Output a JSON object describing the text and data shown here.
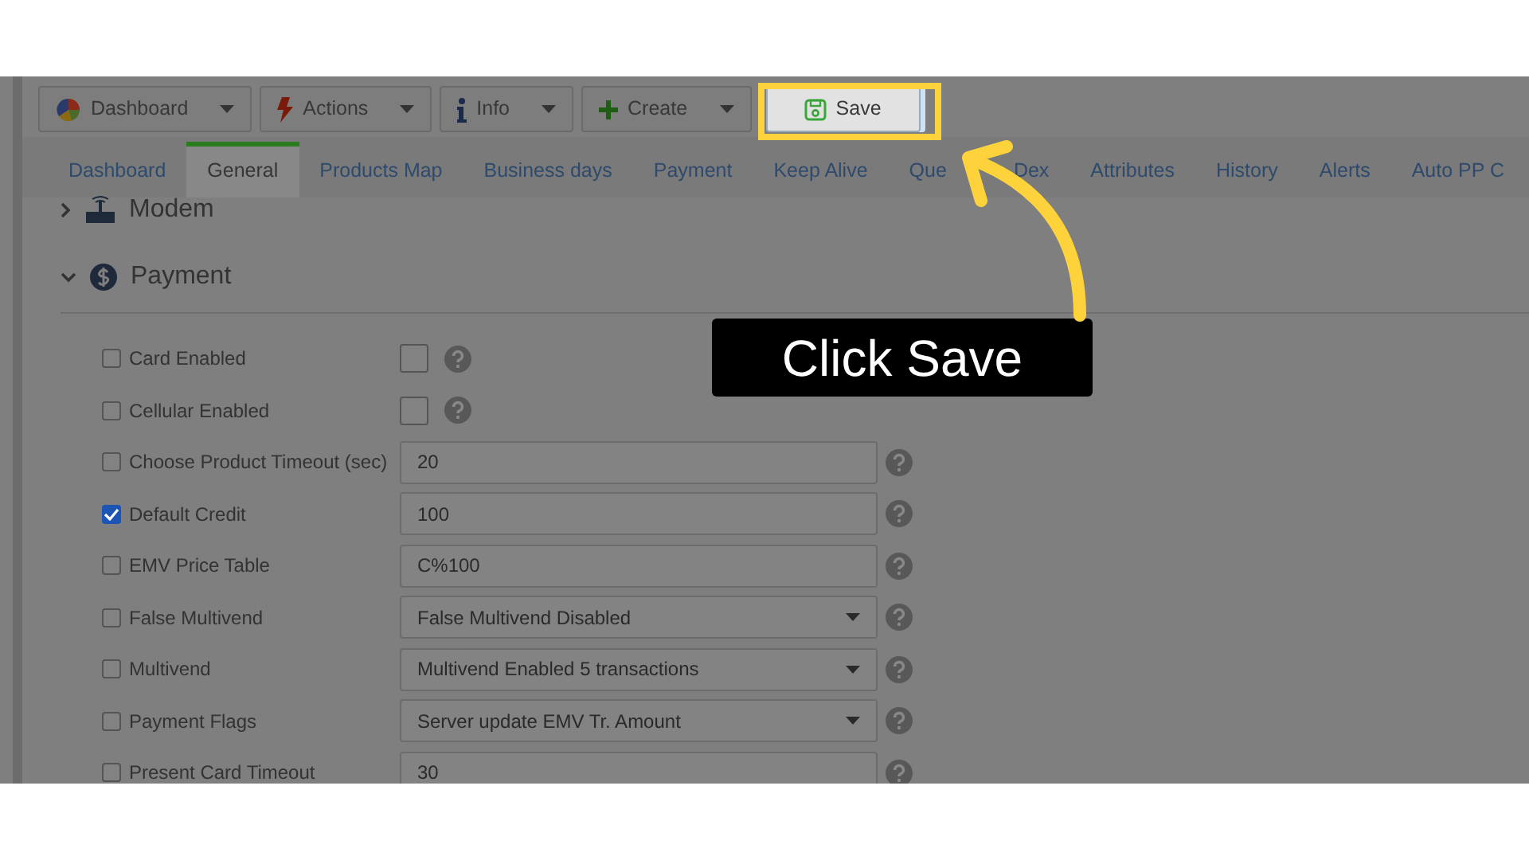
{
  "toolbar": [
    {
      "label": "Dashboard",
      "kind": "menu"
    },
    {
      "label": "Actions",
      "kind": "menu"
    },
    {
      "label": "Info",
      "kind": "menu"
    },
    {
      "label": "Create",
      "kind": "menu"
    },
    {
      "label": "Save",
      "kind": "action"
    }
  ],
  "tabs": [
    {
      "label": "Dashboard",
      "selected": false
    },
    {
      "label": "General",
      "selected": true
    },
    {
      "label": "Products Map",
      "selected": false
    },
    {
      "label": "Business days",
      "selected": false
    },
    {
      "label": "Payment",
      "selected": false
    },
    {
      "label": "Keep Alive",
      "selected": false
    },
    {
      "label": "Que",
      "selected": false
    },
    {
      "label": "Dex",
      "selected": false
    },
    {
      "label": "Attributes",
      "selected": false
    },
    {
      "label": "History",
      "selected": false
    },
    {
      "label": "Alerts",
      "selected": false
    },
    {
      "label": "Auto PP C",
      "selected": false
    }
  ],
  "sections": [
    {
      "title": "Modem",
      "expanded": false
    },
    {
      "title": "Payment",
      "expanded": true
    }
  ],
  "fields": [
    {
      "label": "Card Enabled",
      "checked": false,
      "kind": "checkbox",
      "value_checked": false
    },
    {
      "label": "Cellular Enabled",
      "checked": false,
      "kind": "checkbox",
      "value_checked": false
    },
    {
      "label": "Choose Product Timeout (sec)",
      "checked": false,
      "kind": "text",
      "value": "20"
    },
    {
      "label": "Default Credit",
      "checked": true,
      "kind": "text",
      "value": "100"
    },
    {
      "label": "EMV Price Table",
      "checked": false,
      "kind": "text",
      "value": "C%100"
    },
    {
      "label": "False Multivend",
      "checked": false,
      "kind": "select",
      "value": "False Multivend Disabled"
    },
    {
      "label": "Multivend",
      "checked": false,
      "kind": "select",
      "value": "Multivend Enabled 5 transactions"
    },
    {
      "label": "Payment Flags",
      "checked": false,
      "kind": "select",
      "value": "Server update EMV Tr. Amount"
    },
    {
      "label": "Present Card Timeout",
      "checked": false,
      "kind": "text",
      "value": "30"
    }
  ],
  "callout": {
    "text": "Click Save"
  }
}
